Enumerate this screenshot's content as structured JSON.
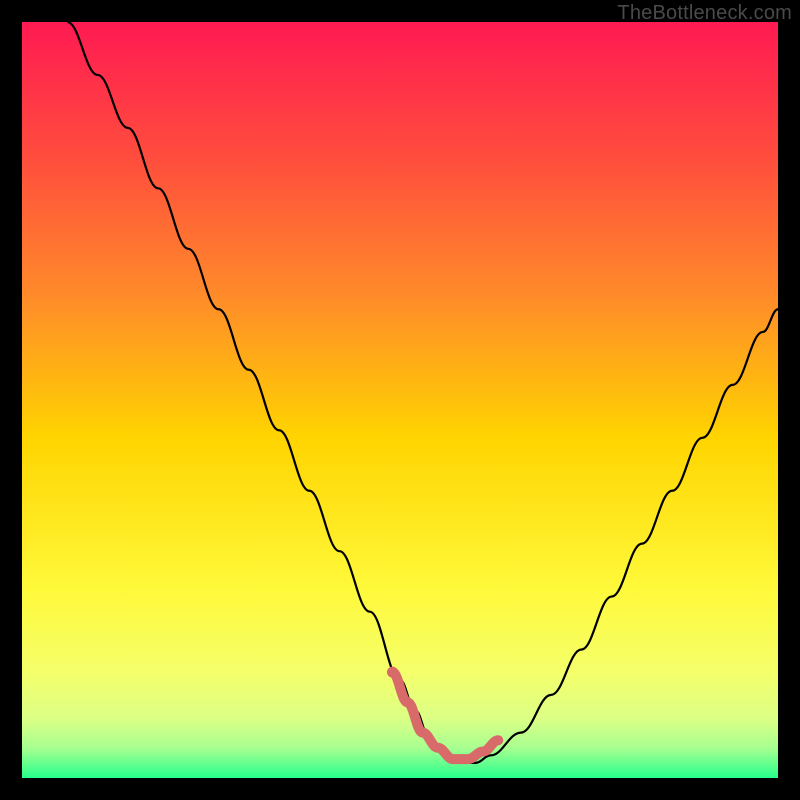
{
  "watermark": "TheBottleneck.com",
  "colors": {
    "background": "#000000",
    "gradient_top": "#ff1a52",
    "gradient_upper_mid": "#ff7a2a",
    "gradient_mid": "#ffd400",
    "gradient_lower_mid": "#f7ff55",
    "gradient_near_bottom": "#d9ff80",
    "gradient_bottom": "#26ff8c",
    "curve": "#000000",
    "highlight": "#d96a6a"
  },
  "chart_data": {
    "type": "line",
    "title": "",
    "xlabel": "",
    "ylabel": "",
    "xlim": [
      0,
      100
    ],
    "ylim": [
      0,
      100
    ],
    "series": [
      {
        "name": "bottleneck-curve",
        "x": [
          6,
          10,
          14,
          18,
          22,
          26,
          30,
          34,
          38,
          42,
          46,
          50,
          52,
          54,
          56,
          58,
          60,
          62,
          66,
          70,
          74,
          78,
          82,
          86,
          90,
          94,
          98,
          100
        ],
        "y": [
          100,
          93,
          86,
          78,
          70,
          62,
          54,
          46,
          38,
          30,
          22,
          13,
          9,
          5,
          3,
          2,
          2,
          3,
          6,
          11,
          17,
          24,
          31,
          38,
          45,
          52,
          59,
          62
        ]
      }
    ],
    "highlight_segment": {
      "name": "optimal-range",
      "x": [
        49,
        51,
        53,
        55,
        57,
        59,
        61,
        63
      ],
      "y": [
        14,
        10,
        6,
        4,
        2.5,
        2.5,
        3.5,
        5
      ]
    }
  }
}
